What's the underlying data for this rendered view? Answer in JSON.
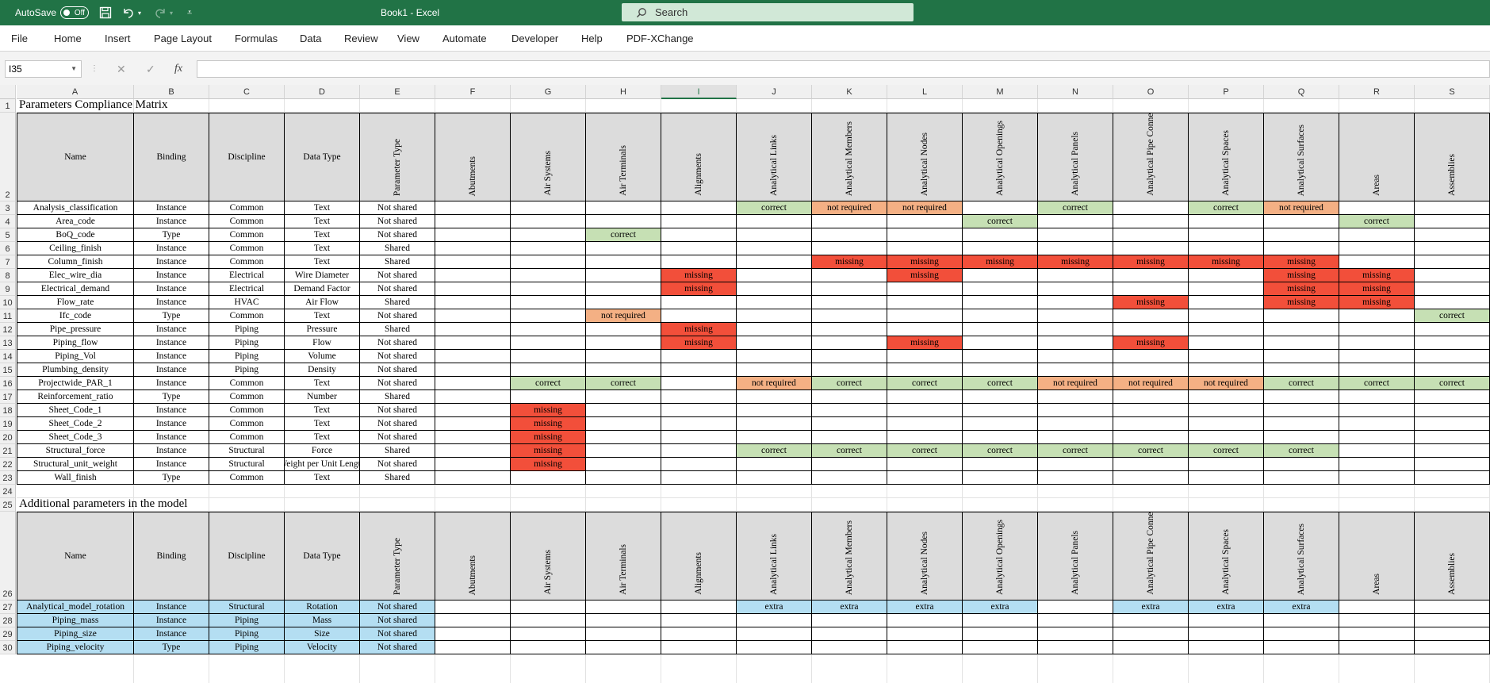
{
  "titlebar": {
    "autosave_label": "AutoSave",
    "autosave_state": "Off",
    "title": "Book1  -  Excel",
    "search_placeholder": "Search"
  },
  "ribbon_tabs": [
    "File",
    "Home",
    "Insert",
    "Page Layout",
    "Formulas",
    "Data",
    "Review",
    "View",
    "Automate",
    "Developer",
    "Help",
    "PDF-XChange"
  ],
  "formula_bar": {
    "name_box": "I35",
    "fx": "fx",
    "formula": ""
  },
  "selected_column": "I",
  "columns": [
    "A",
    "B",
    "C",
    "D",
    "E",
    "F",
    "G",
    "H",
    "I",
    "J",
    "K",
    "L",
    "M",
    "N",
    "O",
    "P",
    "Q",
    "R",
    "S"
  ],
  "rows": [
    "1",
    "2",
    "3",
    "4",
    "5",
    "6",
    "7",
    "8",
    "9",
    "10",
    "11",
    "12",
    "13",
    "14",
    "15",
    "16",
    "17",
    "18",
    "19",
    "20",
    "21",
    "22",
    "23",
    "24",
    "25",
    "26",
    "27",
    "28",
    "29",
    "30"
  ],
  "matrix1": {
    "title": "Parameters Compliance Matrix",
    "headers": [
      "Name",
      "Binding",
      "Discipline",
      "Data Type",
      "Parameter Type",
      "Abutments",
      "Air Systems",
      "Air Terminals",
      "Alignments",
      "Analytical Links",
      "Analytical Members",
      "Analytical Nodes",
      "Analytical Openings",
      "Analytical Panels",
      "Analytical Pipe Connections",
      "Analytical Spaces",
      "Analytical Surfaces",
      "Areas",
      "Assemblies"
    ],
    "rows": [
      {
        "c": [
          "Analysis_classification",
          "Instance",
          "Common",
          "Text",
          "Not shared",
          "",
          "",
          "",
          "",
          "correct",
          "not required",
          "not required",
          "",
          "correct",
          "",
          "correct",
          "not required",
          "",
          ""
        ]
      },
      {
        "c": [
          "Area_code",
          "Instance",
          "Common",
          "Text",
          "Not shared",
          "",
          "",
          "",
          "",
          "",
          "",
          "",
          "correct",
          "",
          "",
          "",
          "",
          "correct",
          ""
        ]
      },
      {
        "c": [
          "BoQ_code",
          "Type",
          "Common",
          "Text",
          "Not shared",
          "",
          "",
          "correct",
          "",
          "",
          "",
          "",
          "",
          "",
          "",
          "",
          "",
          "",
          ""
        ]
      },
      {
        "c": [
          "Ceiling_finish",
          "Instance",
          "Common",
          "Text",
          "Shared",
          "",
          "",
          "",
          "",
          "",
          "",
          "",
          "",
          "",
          "",
          "",
          "",
          "",
          ""
        ]
      },
      {
        "c": [
          "Column_finish",
          "Instance",
          "Common",
          "Text",
          "Shared",
          "",
          "",
          "",
          "",
          "",
          "missing",
          "missing",
          "missing",
          "missing",
          "missing",
          "missing",
          "missing",
          "",
          ""
        ]
      },
      {
        "c": [
          "Elec_wire_dia",
          "Instance",
          "Electrical",
          "Wire Diameter",
          "Not shared",
          "",
          "",
          "",
          "missing",
          "",
          "",
          "missing",
          "",
          "",
          "",
          "",
          "missing",
          "missing",
          ""
        ]
      },
      {
        "c": [
          "Electrical_demand",
          "Instance",
          "Electrical",
          "Demand Factor",
          "Not shared",
          "",
          "",
          "",
          "missing",
          "",
          "",
          "",
          "",
          "",
          "",
          "",
          "missing",
          "missing",
          ""
        ]
      },
      {
        "c": [
          "Flow_rate",
          "Instance",
          "HVAC",
          "Air Flow",
          "Shared",
          "",
          "",
          "",
          "",
          "",
          "",
          "",
          "",
          "",
          "missing",
          "",
          "missing",
          "missing",
          ""
        ]
      },
      {
        "c": [
          "Ifc_code",
          "Type",
          "Common",
          "Text",
          "Not shared",
          "",
          "",
          "not required",
          "",
          "",
          "",
          "",
          "",
          "",
          "",
          "",
          "",
          "",
          "correct"
        ]
      },
      {
        "c": [
          "Pipe_pressure",
          "Instance",
          "Piping",
          "Pressure",
          "Shared",
          "",
          "",
          "",
          "missing",
          "",
          "",
          "",
          "",
          "",
          "",
          "",
          "",
          "",
          ""
        ]
      },
      {
        "c": [
          "Piping_flow",
          "Instance",
          "Piping",
          "Flow",
          "Not shared",
          "",
          "",
          "",
          "missing",
          "",
          "",
          "missing",
          "",
          "",
          "missing",
          "",
          "",
          "",
          ""
        ]
      },
      {
        "c": [
          "Piping_Vol",
          "Instance",
          "Piping",
          "Volume",
          "Not shared",
          "",
          "",
          "",
          "",
          "",
          "",
          "",
          "",
          "",
          "",
          "",
          "",
          "",
          ""
        ]
      },
      {
        "c": [
          "Plumbing_density",
          "Instance",
          "Piping",
          "Density",
          "Not shared",
          "",
          "",
          "",
          "",
          "",
          "",
          "",
          "",
          "",
          "",
          "",
          "",
          "",
          ""
        ]
      },
      {
        "c": [
          "Projectwide_PAR_1",
          "Instance",
          "Common",
          "Text",
          "Not shared",
          "",
          "correct",
          "correct",
          "",
          "not required",
          "correct",
          "correct",
          "correct",
          "not required",
          "not required",
          "not required",
          "correct",
          "correct",
          "correct"
        ]
      },
      {
        "c": [
          "Reinforcement_ratio",
          "Type",
          "Common",
          "Number",
          "Shared",
          "",
          "",
          "",
          "",
          "",
          "",
          "",
          "",
          "",
          "",
          "",
          "",
          "",
          ""
        ]
      },
      {
        "c": [
          "Sheet_Code_1",
          "Instance",
          "Common",
          "Text",
          "Not shared",
          "",
          "missing",
          "",
          "",
          "",
          "",
          "",
          "",
          "",
          "",
          "",
          "",
          "",
          ""
        ]
      },
      {
        "c": [
          "Sheet_Code_2",
          "Instance",
          "Common",
          "Text",
          "Not shared",
          "",
          "missing",
          "",
          "",
          "",
          "",
          "",
          "",
          "",
          "",
          "",
          "",
          "",
          ""
        ]
      },
      {
        "c": [
          "Sheet_Code_3",
          "Instance",
          "Common",
          "Text",
          "Not shared",
          "",
          "missing",
          "",
          "",
          "",
          "",
          "",
          "",
          "",
          "",
          "",
          "",
          "",
          ""
        ]
      },
      {
        "c": [
          "Structural_force",
          "Instance",
          "Structural",
          "Force",
          "Shared",
          "",
          "missing",
          "",
          "",
          "correct",
          "correct",
          "correct",
          "correct",
          "correct",
          "correct",
          "correct",
          "correct",
          "",
          ""
        ]
      },
      {
        "c": [
          "Structural_unit_weight",
          "Instance",
          "Structural",
          "Weight per Unit Length",
          "Not shared",
          "",
          "missing",
          "",
          "",
          "",
          "",
          "",
          "",
          "",
          "",
          "",
          "",
          "",
          ""
        ]
      },
      {
        "c": [
          "Wall_finish",
          "Type",
          "Common",
          "Text",
          "Shared",
          "",
          "",
          "",
          "",
          "",
          "",
          "",
          "",
          "",
          "",
          "",
          "",
          "",
          ""
        ]
      }
    ]
  },
  "matrix2": {
    "title": "Additional parameters in the model",
    "headers": [
      "Name",
      "Binding",
      "Discipline",
      "Data Type",
      "Parameter Type",
      "Abutments",
      "Air Systems",
      "Air Terminals",
      "Alignments",
      "Analytical Links",
      "Analytical Members",
      "Analytical Nodes",
      "Analytical Openings",
      "Analytical Panels",
      "Analytical Pipe Connections",
      "Analytical Spaces",
      "Analytical Surfaces",
      "Areas",
      "Assemblies"
    ],
    "rows": [
      {
        "c": [
          "Analytical_model_rotation",
          "Instance",
          "Structural",
          "Rotation",
          "Not shared",
          "",
          "",
          "",
          "",
          "extra",
          "extra",
          "extra",
          "extra",
          "",
          "extra",
          "extra",
          "extra",
          "",
          ""
        ]
      },
      {
        "c": [
          "Piping_mass",
          "Instance",
          "Piping",
          "Mass",
          "Not shared",
          "",
          "",
          "",
          "",
          "",
          "",
          "",
          "",
          "",
          "",
          "",
          "",
          "",
          ""
        ]
      },
      {
        "c": [
          "Piping_size",
          "Instance",
          "Piping",
          "Size",
          "Not shared",
          "",
          "",
          "",
          "",
          "",
          "",
          "",
          "",
          "",
          "",
          "",
          "",
          "",
          ""
        ]
      },
      {
        "c": [
          "Piping_velocity",
          "Type",
          "Piping",
          "Velocity",
          "Not shared",
          "",
          "",
          "",
          "",
          "",
          "",
          "",
          "",
          "",
          "",
          "",
          "",
          "",
          ""
        ]
      }
    ]
  },
  "status_colors": {
    "correct": "#c6e0b4",
    "not required": "#f4b084",
    "missing": "#f24f3a",
    "extra": "#b4def2",
    "header": "#dcdcdc"
  }
}
